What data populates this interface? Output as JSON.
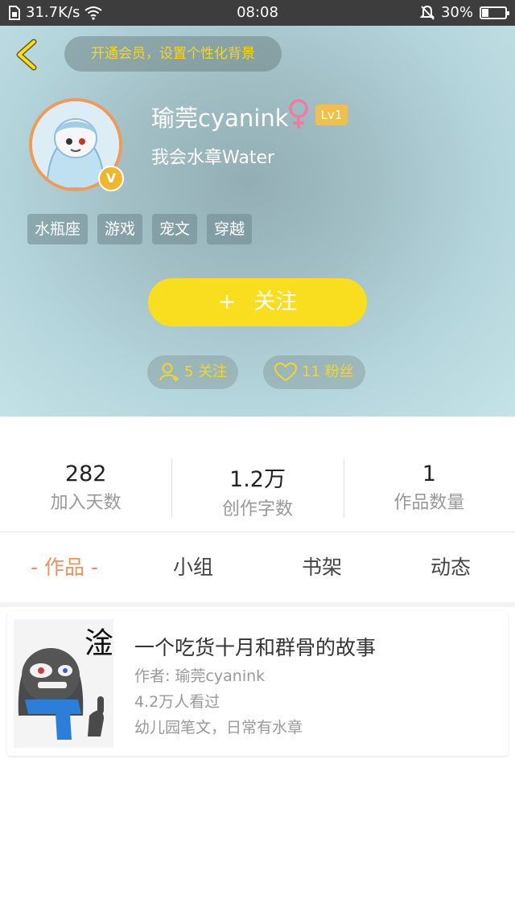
{
  "status_bar": {
    "network_speed": "31.7K/s",
    "time": "08:08",
    "battery": "30%",
    "battery_level": 0.3
  },
  "header": {
    "vip_banner": "开通会员，设置个性化背景",
    "username": "瑜莞cyanink",
    "gender_symbol": "♀",
    "level": "Lv1",
    "signature": "我会水章Water",
    "verified_badge": "V",
    "tags": [
      "水瓶座",
      "游戏",
      "宠文",
      "穿越"
    ],
    "follow_button": {
      "plus": "+",
      "label": "关注"
    },
    "following": "5 关注",
    "fans": "11 粉丝"
  },
  "stats": [
    {
      "value": "282",
      "label": "加入天数"
    },
    {
      "value": "1.2万",
      "label": "创作字数"
    },
    {
      "value": "1",
      "label": "作品数量"
    }
  ],
  "tabs": [
    {
      "label": "- 作品 -",
      "active": true
    },
    {
      "label": "小组",
      "active": false
    },
    {
      "label": "书架",
      "active": false
    },
    {
      "label": "动态",
      "active": false
    }
  ],
  "works": [
    {
      "title": "一个吃货十月和群骨的故事",
      "author": "作者: 瑜莞cyanink",
      "views": "4.2万人看过",
      "description": "幼儿园笔文，日常有水章",
      "cover_text": "淦"
    }
  ],
  "colors": {
    "accent_yellow": "#f8de1e",
    "tab_active": "#f0915a",
    "gender_pink": "#f07aa0",
    "level_badge": "#f0c04a"
  }
}
